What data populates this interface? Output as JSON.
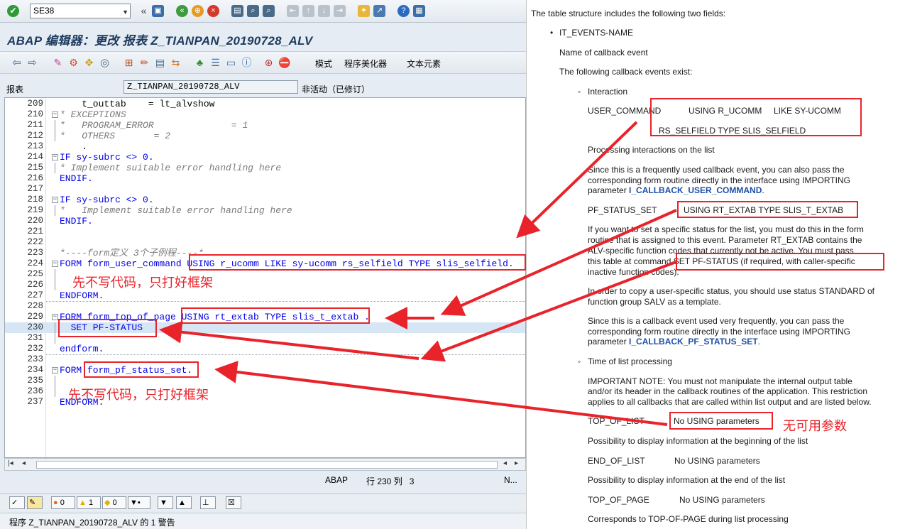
{
  "toolbar": {
    "command_value": "SE38"
  },
  "window": {
    "title": "ABAP 编辑器：更改 报表 Z_TIANPAN_20190728_ALV"
  },
  "app_toolbar": {
    "pattern_label": "模式",
    "pretty_printer_label": "程序美化器",
    "text_elements_label": "文本元素"
  },
  "report": {
    "label": "报表",
    "name": "Z_TIANPAN_20190728_ALV",
    "status": "非活动（已修订）"
  },
  "code_lines": [
    {
      "no": "209",
      "text": "    t_outtab    = lt_alvshow"
    },
    {
      "no": "210",
      "text": "* EXCEPTIONS"
    },
    {
      "no": "211",
      "text": "*   PROGRAM_ERROR              = 1"
    },
    {
      "no": "212",
      "text": "*   OTHERS       = 2"
    },
    {
      "no": "213",
      "text": "    ."
    },
    {
      "no": "214",
      "text": "IF sy-subrc <> 0."
    },
    {
      "no": "215",
      "text": "* Implement suitable error handling here"
    },
    {
      "no": "216",
      "text": "ENDIF."
    },
    {
      "no": "217",
      "text": ""
    },
    {
      "no": "218",
      "text": "IF sy-subrc <> 0."
    },
    {
      "no": "219",
      "text": "*   Implement suitable error handling here"
    },
    {
      "no": "220",
      "text": "ENDIF."
    },
    {
      "no": "221",
      "text": ""
    },
    {
      "no": "222",
      "text": ""
    },
    {
      "no": "223",
      "text": "*----form定义 3个子例程----*"
    },
    {
      "no": "224",
      "text": "FORM form_user_command USING r_ucomm LIKE sy-ucomm rs_selfield TYPE slis_selfield."
    },
    {
      "no": "225",
      "text": ""
    },
    {
      "no": "226",
      "text": ""
    },
    {
      "no": "227",
      "text": "ENDFORM."
    },
    {
      "no": "228",
      "text": ""
    },
    {
      "no": "229",
      "text": "FORM form_top_of_page USING rt_extab TYPE slis_t_extab ."
    },
    {
      "no": "230",
      "text": "  SET PF-STATUS"
    },
    {
      "no": "231",
      "text": ""
    },
    {
      "no": "232",
      "text": "endform."
    },
    {
      "no": "233",
      "text": ""
    },
    {
      "no": "234",
      "text": "FORM form_pf_status_set."
    },
    {
      "no": "235",
      "text": ""
    },
    {
      "no": "236",
      "text": ""
    },
    {
      "no": "237",
      "text": "ENDFORM."
    }
  ],
  "status_row": {
    "language": "ABAP",
    "position": "行 230 列   3",
    "mode": "N..."
  },
  "message_bar": {
    "errors": "0",
    "warnings": "1",
    "infos": "0"
  },
  "status_bar": {
    "text": "程序 Z_TIANPAN_20190728_ALV 的 1 警告"
  },
  "help": {
    "intro": "The table structure includes the following two fields:",
    "field": "IT_EVENTS-NAME",
    "field_desc": "Name of callback event",
    "events_exist": "The following callback events exist:",
    "interaction": "Interaction",
    "user_command": "USER_COMMAND",
    "user_command_sig1": "USING R_UCOMM     LIKE SY-UCOMM",
    "user_command_sig2": "RS_SELFIELD TYPE SLIS_SELFIELD",
    "processing": "Processing interactions on the list",
    "since1_a": "Since this is a frequently used callback event, you can also pass the",
    "since1_b": "corresponding form routine directly in the interface using IMPORTING",
    "since1_c": "parameter ",
    "since1_link": "I_CALLBACK_USER_COMMAND",
    "pf_status_set": "PF_STATUS_SET",
    "pf_status_sig": "USING RT_EXTAB TYPE SLIS_T_EXTAB",
    "pf_a": "If you want to set a specific status for the list, you must do this in the form",
    "pf_b": "routine that is assigned to this event. Parameter RT_EXTAB contains the",
    "pf_c": "ALV-specific function codes that currently not be active. You must pass",
    "pf_d1": "this table at command ",
    "pf_d2": "SET PF-STATUS (if required, with caller-specific",
    "pf_e": "inactive function codes).",
    "copy_a": "In order to copy a user-specific status, you should use status STANDARD of",
    "copy_b": "function group SALV as a template.",
    "since2_a": "Since this is a callback event used very frequently, you can pass the",
    "since2_b": "corresponding form routine directly in the interface using IMPORTING",
    "since2_c": "parameter ",
    "since2_link": "I_CALLBACK_PF_STATUS_SET",
    "time": "Time of list processing",
    "imp_a": "IMPORTANT NOTE: You must not manipulate the internal output table",
    "imp_b": "and/or its header in the callback routines of the application. This restriction",
    "imp_c": "applies to all callbacks that are called within list output and are listed below.",
    "top_of_list": "TOP_OF_LIST",
    "no_using": "No USING parameters",
    "top_of_list_desc": "Possibility to display information at the beginning of the list",
    "end_of_list": "END_OF_LIST",
    "end_of_list_desc": "Possibility to display information at the end of the list",
    "top_of_page": "TOP_OF_PAGE",
    "top_of_page_desc": "Corresponds to TOP-OF-PAGE during list processing"
  },
  "annotations": {
    "frame_only_1": "先不写代码，只打好框架",
    "frame_only_2": "先不写代码，只打好框架",
    "no_params": "无可用参数"
  },
  "colors": {
    "annotation_red": "#e8232a",
    "keyword_blue": "#0000e6",
    "title_navy": "#1d3a5e",
    "link_blue": "#1e4fa6"
  }
}
